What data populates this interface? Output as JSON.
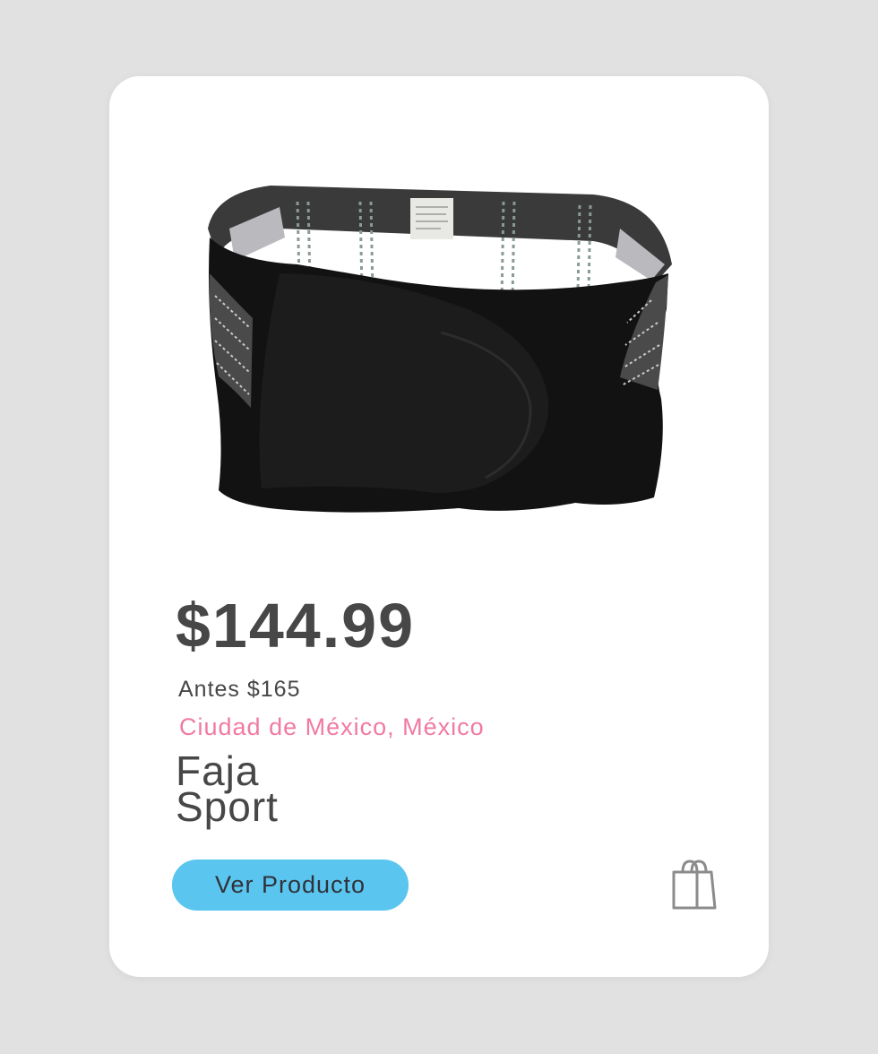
{
  "product": {
    "price": "$144.99",
    "old_price": "Antes $165",
    "location": "Ciudad de México, México",
    "name_line1": "Faja",
    "name_line2": "Sport",
    "image_description": "black lumbar support belt"
  },
  "actions": {
    "view_label": "Ver Producto",
    "cart_icon": "shopping-bag-icon"
  },
  "colors": {
    "background": "#e1e1e1",
    "card": "#ffffff",
    "text": "#474747",
    "location": "#f07aa3",
    "button": "#5ac6ef"
  }
}
